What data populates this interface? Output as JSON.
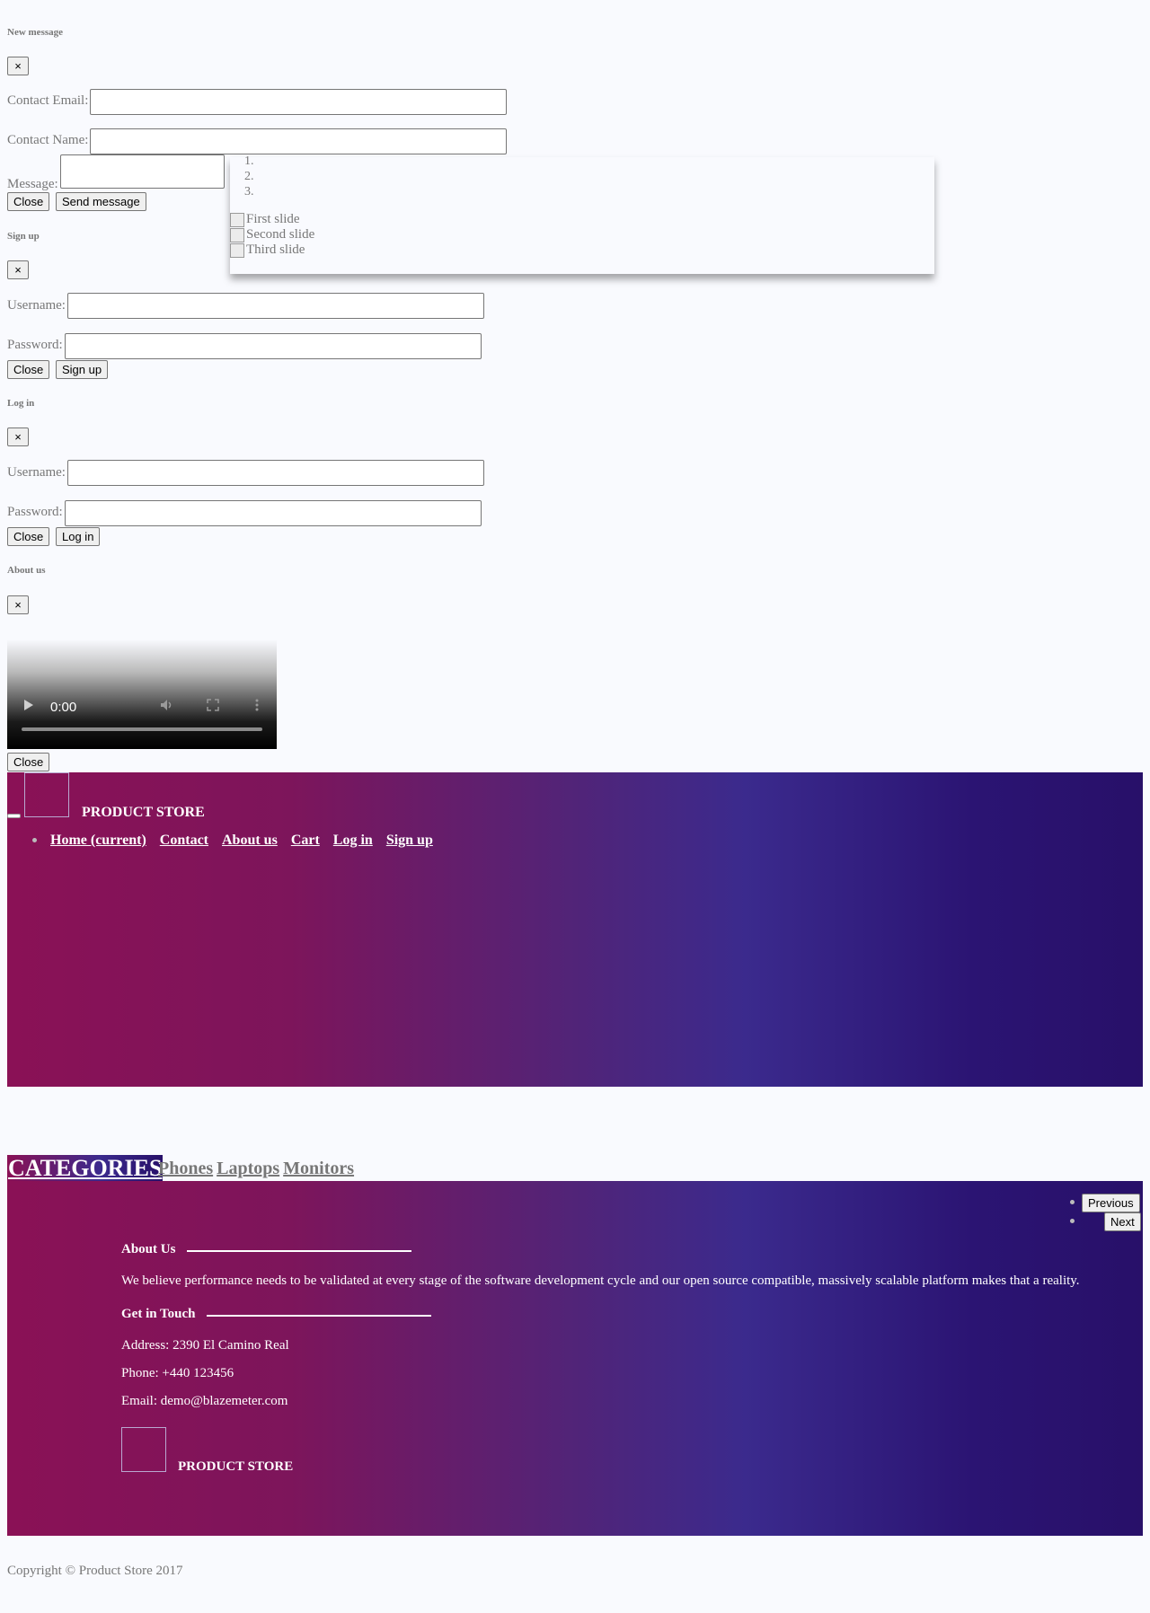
{
  "new_message_modal": {
    "title": "New message",
    "close_x": "×",
    "email_label": "Contact Email:",
    "name_label": "Contact Name:",
    "message_label": "Message:",
    "close_button": "Close",
    "send_button": "Send message"
  },
  "signup_modal": {
    "title": "Sign up",
    "close_x": "×",
    "username_label": "Username:",
    "password_label": "Password:",
    "close_button": "Close",
    "submit_button": "Sign up"
  },
  "login_modal": {
    "title": "Log in",
    "close_x": "×",
    "username_label": "Username:",
    "password_label": "Password:",
    "close_button": "Close",
    "submit_button": "Log in"
  },
  "about_modal": {
    "title": "About us",
    "close_x": "×",
    "video_time": "0:00",
    "close_button": "Close"
  },
  "carousel": {
    "indicators": [
      "1.",
      "2.",
      "3."
    ],
    "slides": [
      "First slide",
      "Second slide",
      "Third slide"
    ],
    "previous": "Previous",
    "next": "Next"
  },
  "navbar": {
    "brand": "PRODUCT STORE",
    "links": [
      "Home (current)",
      "Contact",
      "About us",
      "Cart",
      "Log in",
      "Sign up"
    ]
  },
  "categories": {
    "heading": "CATEGORIES",
    "items": [
      "Phones",
      "Laptops",
      "Monitors"
    ]
  },
  "footer": {
    "about_title": "About Us",
    "about_text": "We believe performance needs to be validated at every stage of the software development cycle and our open source compatible, massively scalable platform makes that a reality.",
    "contact_title": "Get in Touch",
    "address": "Address: 2390 El Camino Real",
    "phone": "Phone: +440 123456",
    "email": "Email: demo@blazemeter.com",
    "brand": "PRODUCT STORE",
    "copyright": "Copyright © Product Store 2017"
  },
  "icons": {
    "play": "play-icon",
    "volume": "volume-icon",
    "fullscreen": "fullscreen-icon",
    "more": "more-vertical-icon"
  },
  "colors": {
    "page_bg": "#f9fafe",
    "text": "#777777",
    "gradient_start": "#8a1156",
    "gradient_end": "#281069"
  }
}
